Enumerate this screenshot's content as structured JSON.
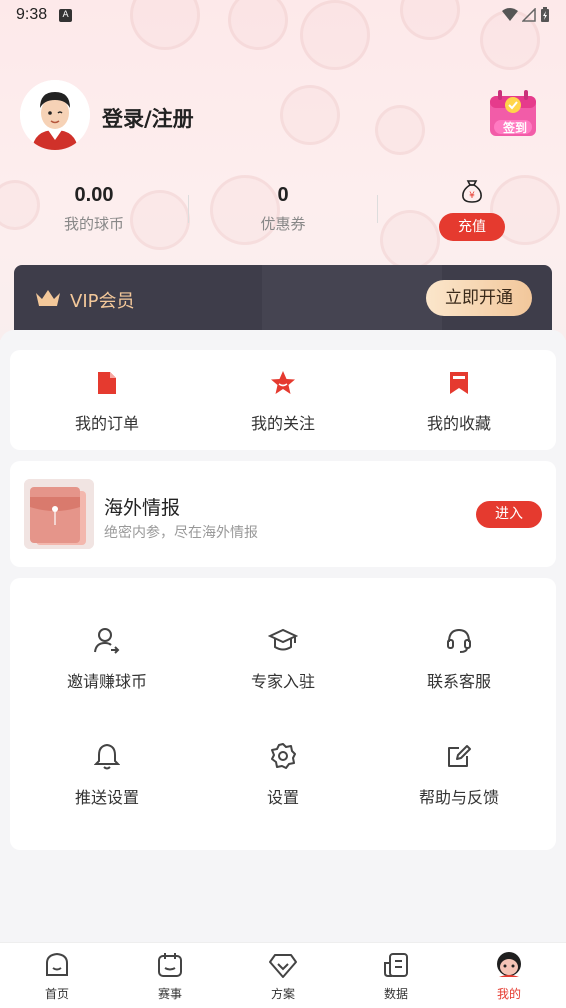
{
  "status_bar": {
    "time": "9:38",
    "notif_badge": "A"
  },
  "profile": {
    "login_label": "登录/注册",
    "signin_badge": "签到"
  },
  "stats": [
    {
      "value": "0.00",
      "label": "我的球币"
    },
    {
      "value": "0",
      "label": "优惠券"
    }
  ],
  "recharge": {
    "label": "充值",
    "icon": "money-bag-icon"
  },
  "vip": {
    "label": "VIP会员",
    "button": "立即开通"
  },
  "quick_links": [
    {
      "label": "我的订单",
      "icon": "order-icon"
    },
    {
      "label": "我的关注",
      "icon": "star-icon"
    },
    {
      "label": "我的收藏",
      "icon": "bookmark-icon"
    }
  ],
  "overseas": {
    "title": "海外情报",
    "subtitle": "绝密内参，尽在海外情报",
    "button": "进入"
  },
  "tools": [
    {
      "label": "邀请赚球币",
      "icon": "invite-user-icon"
    },
    {
      "label": "专家入驻",
      "icon": "graduation-cap-icon"
    },
    {
      "label": "联系客服",
      "icon": "headset-icon"
    },
    {
      "label": "推送设置",
      "icon": "bell-icon"
    },
    {
      "label": "设置",
      "icon": "gear-icon"
    },
    {
      "label": "帮助与反馈",
      "icon": "edit-icon"
    }
  ],
  "tabbar": [
    {
      "label": "首页",
      "icon": "home-icon",
      "active": false
    },
    {
      "label": "赛事",
      "icon": "calendar-icon",
      "active": false
    },
    {
      "label": "方案",
      "icon": "diamond-icon",
      "active": false
    },
    {
      "label": "数据",
      "icon": "data-icon",
      "active": false
    },
    {
      "label": "我的",
      "icon": "mine-icon",
      "active": true
    }
  ],
  "colors": {
    "accent": "#e53a2f",
    "vip_bg": "#3e3d4a",
    "vip_gold": "#f3c89a"
  }
}
